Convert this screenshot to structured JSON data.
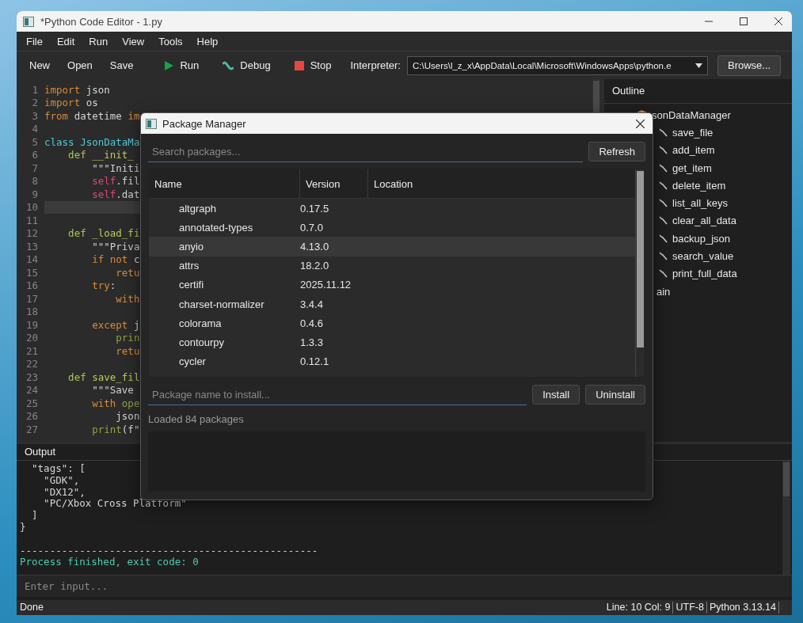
{
  "window": {
    "title": "*Python Code Editor - 1.py"
  },
  "menu": [
    "File",
    "Edit",
    "Run",
    "View",
    "Tools",
    "Help"
  ],
  "toolbar": {
    "buttons": [
      {
        "label": "New",
        "kind": "plain"
      },
      {
        "label": "Open",
        "kind": "plain"
      },
      {
        "label": "Save",
        "kind": "plain"
      },
      {
        "label": "Run",
        "kind": "run"
      },
      {
        "label": "Debug",
        "kind": "debug"
      },
      {
        "label": "Stop",
        "kind": "stop"
      }
    ],
    "interpreter_label": "Interpreter:",
    "interpreter": "C:\\Users\\l_z_x\\AppData\\Local\\Microsoft\\WindowsApps\\python.e",
    "browse": "Browse..."
  },
  "editor": {
    "lines": [
      {
        "num": "1",
        "current": false,
        "tokens": [
          {
            "text": "import",
            "kind": "kw"
          },
          {
            "text": " json",
            "kind": "p"
          }
        ]
      },
      {
        "num": "2",
        "current": false,
        "tokens": [
          {
            "text": "import",
            "kind": "kw"
          },
          {
            "text": " os",
            "kind": "p"
          }
        ]
      },
      {
        "num": "3",
        "current": false,
        "tokens": [
          {
            "text": "from",
            "kind": "kw"
          },
          {
            "text": " datetime ",
            "kind": "p"
          },
          {
            "text": "im",
            "kind": "kw"
          }
        ]
      },
      {
        "num": "4",
        "current": false
      },
      {
        "num": "5",
        "current": false,
        "tokens": [
          {
            "text": "class",
            "kind": "cls"
          },
          {
            "text": " JsonDataMa",
            "kind": "cls"
          }
        ]
      },
      {
        "num": "6",
        "current": false,
        "tokens": [
          {
            "text": "    def",
            "kind": "def"
          },
          {
            "text": " __init_",
            "kind": "fn"
          }
        ]
      },
      {
        "num": "7",
        "current": false,
        "tokens": [
          {
            "text": "        \"\"\"Initi",
            "kind": "str"
          }
        ]
      },
      {
        "num": "8",
        "current": false,
        "tokens": [
          {
            "text": "        self",
            "kind": "self"
          },
          {
            "text": ".fil",
            "kind": "p"
          }
        ]
      },
      {
        "num": "9",
        "current": false,
        "tokens": [
          {
            "text": "        self",
            "kind": "self"
          },
          {
            "text": ".dat",
            "kind": "p"
          }
        ]
      },
      {
        "num": "10",
        "current": true
      },
      {
        "num": "11",
        "current": false
      },
      {
        "num": "12",
        "current": false,
        "tokens": [
          {
            "text": "    def",
            "kind": "def"
          },
          {
            "text": " _load_fi",
            "kind": "fn"
          }
        ]
      },
      {
        "num": "13",
        "current": false,
        "tokens": [
          {
            "text": "        \"\"\"Priva",
            "kind": "str"
          }
        ]
      },
      {
        "num": "14",
        "current": false,
        "tokens": [
          {
            "text": "        if not",
            "kind": "kw"
          },
          {
            "text": " c",
            "kind": "p"
          }
        ]
      },
      {
        "num": "15",
        "current": false,
        "tokens": [
          {
            "text": "            retu",
            "kind": "kw"
          }
        ]
      },
      {
        "num": "16",
        "current": false,
        "tokens": [
          {
            "text": "        try",
            "kind": "kw"
          },
          {
            "text": ":",
            "kind": "p"
          }
        ]
      },
      {
        "num": "17",
        "current": false,
        "tokens": [
          {
            "text": "            with",
            "kind": "kw"
          }
        ]
      },
      {
        "num": "18",
        "current": false
      },
      {
        "num": "19",
        "current": false,
        "tokens": [
          {
            "text": "        except",
            "kind": "kw"
          },
          {
            "text": " j",
            "kind": "p"
          }
        ]
      },
      {
        "num": "20",
        "current": false,
        "tokens": [
          {
            "text": "            prin",
            "kind": "bi"
          }
        ]
      },
      {
        "num": "21",
        "current": false,
        "tokens": [
          {
            "text": "            retu",
            "kind": "kw"
          }
        ]
      },
      {
        "num": "22",
        "current": false
      },
      {
        "num": "23",
        "current": false,
        "tokens": [
          {
            "text": "    def",
            "kind": "def"
          },
          {
            "text": " save_fil",
            "kind": "fn"
          }
        ]
      },
      {
        "num": "24",
        "current": false,
        "tokens": [
          {
            "text": "        \"\"\"Save",
            "kind": "str"
          }
        ]
      },
      {
        "num": "25",
        "current": false,
        "tokens": [
          {
            "text": "        with",
            "kind": "kw"
          },
          {
            "text": " ope",
            "kind": "bi"
          }
        ]
      },
      {
        "num": "26",
        "current": false,
        "tokens": [
          {
            "text": "            json",
            "kind": "p"
          }
        ]
      },
      {
        "num": "27",
        "current": false,
        "tokens": [
          {
            "text": "        print",
            "kind": "bi"
          },
          {
            "text": "(f\"",
            "kind": "p"
          }
        ]
      }
    ]
  },
  "outline": {
    "title": "Outline",
    "tree": [
      {
        "label": "sonDataManager",
        "kind": "class",
        "children": [
          {
            "label": "save_file",
            "kind": "method"
          },
          {
            "label": "add_item",
            "kind": "method"
          },
          {
            "label": "get_item",
            "kind": "method"
          },
          {
            "label": "delete_item",
            "kind": "method"
          },
          {
            "label": "list_all_keys",
            "kind": "method"
          },
          {
            "label": "clear_all_data",
            "kind": "method"
          },
          {
            "label": "backup_json",
            "kind": "method"
          },
          {
            "label": "search_value",
            "kind": "method"
          },
          {
            "label": "print_full_data",
            "kind": "method"
          }
        ]
      },
      {
        "label": "ain",
        "kind": "function"
      }
    ]
  },
  "output": {
    "title": "Output",
    "lines": [
      {
        "text": "  \"tags\": [",
        "kind": "normal"
      },
      {
        "text": "    \"GDK\",",
        "kind": "normal"
      },
      {
        "text": "    \"DX12\",",
        "kind": "normal"
      },
      {
        "text": "    \"PC/Xbox Cross Platform\"",
        "kind": "normal"
      },
      {
        "text": "  ]",
        "kind": "normal"
      },
      {
        "text": "}",
        "kind": "normal"
      },
      {
        "kind": "blank"
      },
      {
        "text": "--------------------------------------------------",
        "kind": "normal"
      },
      {
        "text": "Process finished, exit code: 0",
        "kind": "success"
      }
    ],
    "input_placeholder": "Enter input..."
  },
  "status_bar": {
    "message": "Done",
    "position": "Line: 10  Col: 9",
    "encoding": "UTF-8",
    "python": "Python 3.13.14"
  },
  "dialog": {
    "title": "Package Manager",
    "search_placeholder": "Search packages...",
    "refresh": "Refresh",
    "columns": [
      "Name",
      "Version",
      "Location"
    ],
    "rows": [
      {
        "name": "altgraph",
        "version": "0.17.5",
        "selected": false
      },
      {
        "name": "annotated-types",
        "version": "0.7.0",
        "selected": false
      },
      {
        "name": "anyio",
        "version": "4.13.0",
        "selected": true
      },
      {
        "name": "attrs",
        "version": "18.2.0",
        "selected": false
      },
      {
        "name": "certifi",
        "version": "2025.11.12",
        "selected": false
      },
      {
        "name": "charset-normalizer",
        "version": "3.4.4",
        "selected": false
      },
      {
        "name": "colorama",
        "version": "0.4.6",
        "selected": false
      },
      {
        "name": "contourpy",
        "version": "1.3.3",
        "selected": false
      },
      {
        "name": "cycler",
        "version": "0.12.1",
        "selected": false
      }
    ],
    "install_placeholder": "Package name to install...",
    "install": "Install",
    "uninstall": "Uninstall",
    "status": "Loaded 84 packages"
  }
}
